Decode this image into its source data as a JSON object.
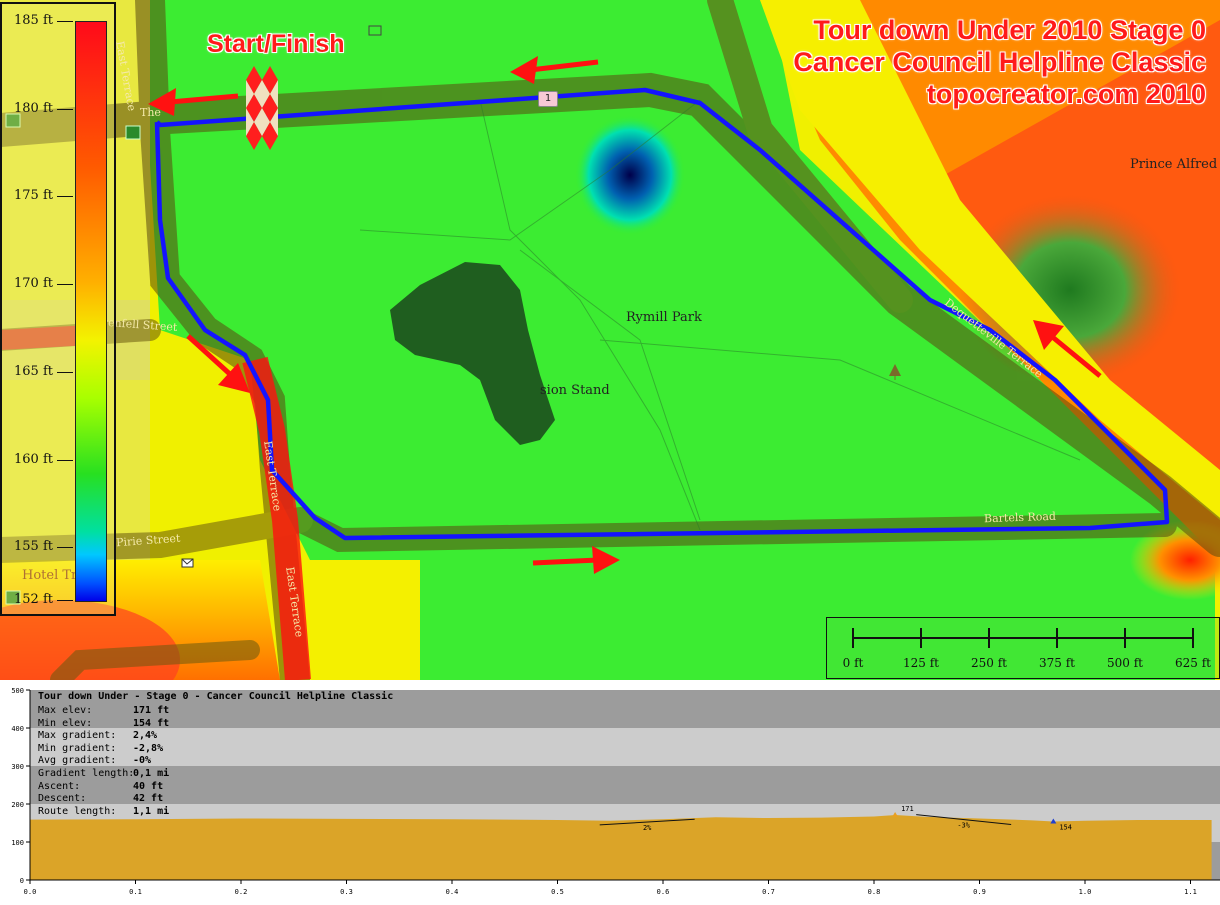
{
  "map": {
    "title_lines": [
      "Tour down Under 2010 Stage 0",
      "Cancer Council Helpline Classic",
      "topocreator.com 2010"
    ],
    "start_finish_label": "Start/Finish",
    "route_marker": "1",
    "place_labels": {
      "park": "Rymill Park",
      "stand": "sion Stand",
      "prince_alfred": "Prince Alfred C",
      "hotel": "Hotel Tr"
    },
    "street_labels": {
      "east_terrace_top": "East Terrace",
      "east_terrace_mid": "East Terrace",
      "east_terrace_low": "East Terrace",
      "grenfell": "Grenfell Street",
      "pirie": "Pirie Street",
      "bartels": "Bartels Road",
      "dequetteville": "Dequetteville Terrace",
      "the": "The"
    },
    "icons": [
      "start-finish-flag-icon",
      "direction-arrow-icon",
      "restaurant-icon",
      "tree-icon",
      "mail-icon",
      "castle-icon"
    ],
    "colors": {
      "route": "#1414ff",
      "arrows": "#ff1111",
      "title_text": "#ff1a1a",
      "park_green": "#33ee33"
    }
  },
  "legend": {
    "labels": [
      "185 ft",
      "180 ft",
      "175 ft",
      "170 ft",
      "165 ft",
      "160 ft",
      "155 ft",
      "152 ft"
    ],
    "values": [
      185,
      180,
      175,
      170,
      165,
      160,
      155,
      152
    ]
  },
  "scale_bar": {
    "labels": [
      "0 ft",
      "125 ft",
      "250 ft",
      "375 ft",
      "500 ft",
      "625 ft"
    ]
  },
  "profile": {
    "title": "Tour down Under - Stage 0 - Cancer Council Helpline Classic",
    "stats": [
      {
        "label": "Max elev:",
        "value": "171 ft"
      },
      {
        "label": "Min elev:",
        "value": "154 ft"
      },
      {
        "label": "Max gradient:",
        "value": "2,4%"
      },
      {
        "label": "Min gradient:",
        "value": "-2,8%"
      },
      {
        "label": "Avg gradient:",
        "value": "-0%"
      },
      {
        "label": "Gradient length:",
        "value": "0,1 mi"
      },
      {
        "label": "Ascent:",
        "value": "40 ft"
      },
      {
        "label": "Descent:",
        "value": "42 ft"
      },
      {
        "label": "Route length:",
        "value": "1,1 mi"
      }
    ],
    "annotations": {
      "max": "171",
      "min": "154",
      "max_gradient": "2%",
      "min_gradient": "-3%"
    },
    "colors": {
      "fill": "#dba428",
      "band_dark": "#9c9c9c",
      "band_light": "#cccccc"
    }
  },
  "chart_data": {
    "type": "area",
    "title": "Tour down Under - Stage 0 - Cancer Council Helpline Classic",
    "xlabel": "",
    "ylabel": "",
    "xlim": [
      0.0,
      1.12
    ],
    "ylim": [
      0,
      500
    ],
    "x_ticks": [
      "0.0",
      "0.1",
      "0.2",
      "0.3",
      "0.4",
      "0.5",
      "0.6",
      "0.7",
      "0.8",
      "0.9",
      "1.0",
      "1.1"
    ],
    "y_ticks": [
      "0",
      "100",
      "200",
      "300",
      "400",
      "500"
    ],
    "x": [
      0.0,
      0.1,
      0.2,
      0.3,
      0.4,
      0.5,
      0.55,
      0.6,
      0.65,
      0.7,
      0.75,
      0.8,
      0.82,
      0.85,
      0.9,
      0.95,
      0.97,
      1.0,
      1.05,
      1.12
    ],
    "y": [
      159,
      160,
      162,
      161,
      160,
      158,
      156,
      160,
      165,
      163,
      164,
      167,
      171,
      166,
      162,
      157,
      154,
      156,
      158,
      158
    ],
    "max_point": {
      "x": 0.82,
      "y": 171
    },
    "min_point": {
      "x": 0.97,
      "y": 154
    },
    "gradient_segments": [
      {
        "x": [
          0.54,
          0.63
        ],
        "label": "2%"
      },
      {
        "x": [
          0.84,
          0.93
        ],
        "label": "-3%"
      }
    ],
    "grid": true
  }
}
